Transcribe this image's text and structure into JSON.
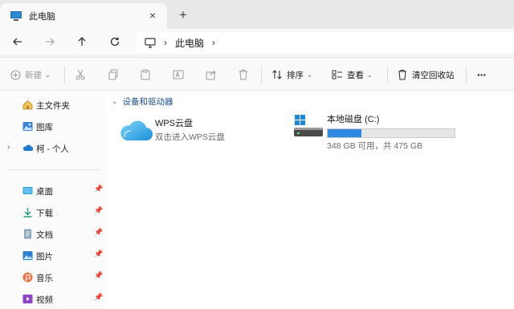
{
  "tab": {
    "title": "此电脑",
    "close": "×",
    "new_tab": "+"
  },
  "nav": {
    "back": "←",
    "forward": "→",
    "up": "↑",
    "refresh": "⟳"
  },
  "address": {
    "path": "此电脑",
    "chevron": "›"
  },
  "command_bar": {
    "new_label": "新建",
    "sort_label": "排序",
    "view_label": "查看",
    "recycle_label": "清空回收站",
    "more": "···"
  },
  "sidebar": {
    "items": [
      {
        "label": "主文件夹",
        "icon": "home-icon"
      },
      {
        "label": "图库",
        "icon": "gallery-icon"
      },
      {
        "label": "柯 - 个人",
        "icon": "onedrive-cloud-icon"
      }
    ],
    "quick_access": [
      {
        "label": "桌面",
        "icon": "desktop-icon",
        "pinned": true
      },
      {
        "label": "下载",
        "icon": "download-icon",
        "pinned": true
      },
      {
        "label": "文档",
        "icon": "documents-icon",
        "pinned": true
      },
      {
        "label": "图片",
        "icon": "pictures-icon",
        "pinned": true
      },
      {
        "label": "音乐",
        "icon": "music-icon",
        "pinned": true
      },
      {
        "label": "视频",
        "icon": "videos-icon",
        "pinned": true
      }
    ]
  },
  "main": {
    "group_title": "设备和驱动器",
    "wps": {
      "name": "WPS云盘",
      "subtitle": "双击进入WPS云盘",
      "icon": "wps-cloud-icon"
    },
    "drive": {
      "name": "本地磁盘 (C:)",
      "space": "348 GB 可用，共 475 GB",
      "used_fraction": 0.267,
      "icon": "drive-icon"
    }
  },
  "colors": {
    "accent": "#2e8ae0",
    "group_title": "#1f4e8c"
  }
}
